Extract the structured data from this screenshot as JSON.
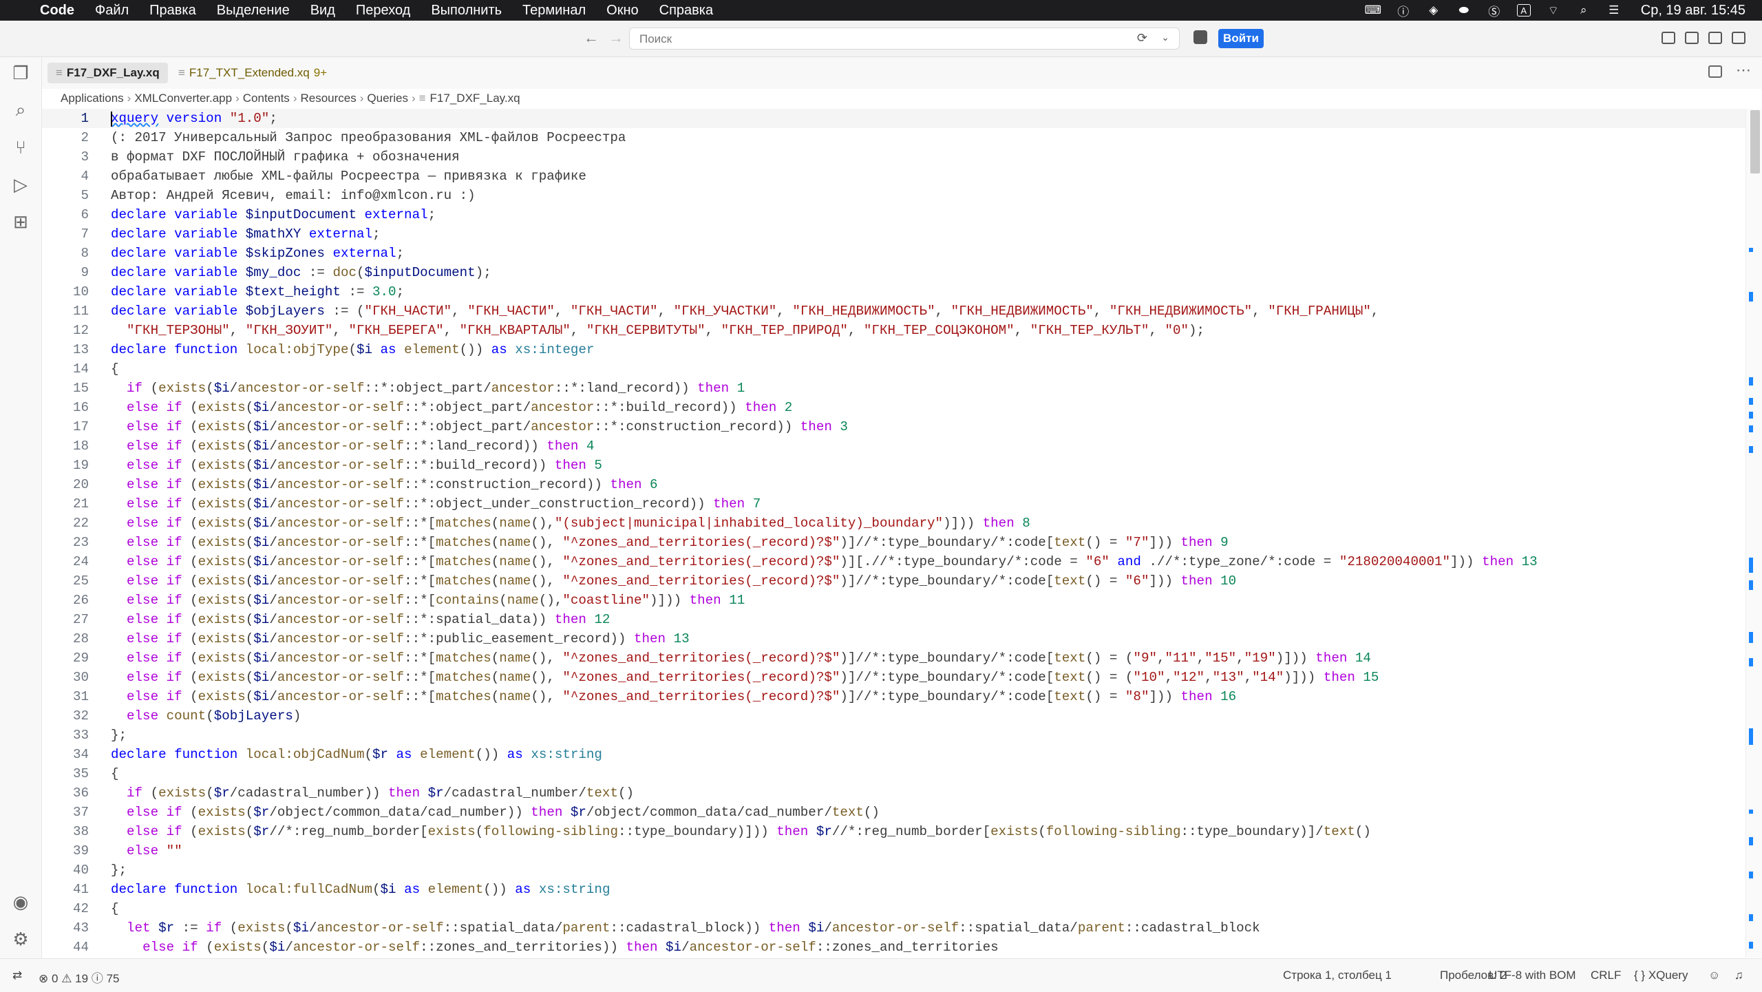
{
  "menubar": {
    "app": "Code",
    "items": [
      "Файл",
      "Правка",
      "Выделение",
      "Вид",
      "Переход",
      "Выполнить",
      "Терминал",
      "Окно",
      "Справка"
    ],
    "keyboard_layout": "A",
    "clock": "Ср, 19 авг.  15:45"
  },
  "titlebar": {
    "search_placeholder": "Поиск",
    "sign_in": "Войти"
  },
  "tabs": [
    {
      "label": "F17_DXF_Lay.xq",
      "active": true
    },
    {
      "label": "F17_TXT_Extended.xq",
      "badge": "9+"
    }
  ],
  "breadcrumb": [
    "Applications",
    "XMLConverter.app",
    "Contents",
    "Resources",
    "Queries",
    "F17_DXF_Lay.xq"
  ],
  "status": {
    "errors": "0",
    "warnings": "19",
    "infos": "75",
    "position": "Строка 1, столбец 1",
    "spaces": "Пробелов: 2",
    "encoding": "UTF-8 with BOM",
    "eol": "CRLF",
    "language": "XQuery"
  },
  "code_lines": [
    "xquery version \"1.0\";",
    "(: 2017 Универсальный Запрос преобразования XML-файлов Росреестра",
    "в формат DXF ПОСЛОЙНЫЙ графика + обозначения",
    "обрабатывает любые XML-файлы Росреестра — привязка к графике",
    "Автор: Андрей Ясевич, email: info@xmlcon.ru :)",
    "declare variable $inputDocument external;",
    "declare variable $mathXY external;",
    "declare variable $skipZones external;",
    "declare variable $my_doc := doc($inputDocument);",
    "declare variable $text_height := 3.0;",
    "declare variable $objLayers := (\"ГКН_ЧАСТИ\", \"ГКН_ЧАСТИ\", \"ГКН_ЧАСТИ\", \"ГКН_УЧАСТКИ\", \"ГКН_НЕДВИЖИМОСТЬ\", \"ГКН_НЕДВИЖИМОСТЬ\", \"ГКН_НЕДВИЖИМОСТЬ\", \"ГКН_ГРАНИЦЫ\",",
    "  \"ГКН_ТЕРЗОНЫ\", \"ГКН_ЗОУИТ\", \"ГКН_БЕРЕГА\", \"ГКН_КВАРТАЛЫ\", \"ГКН_СЕРВИТУТЫ\", \"ГКН_ТЕР_ПРИРОД\", \"ГКН_ТЕР_СОЦЭКОНОМ\", \"ГКН_ТЕР_КУЛЬТ\", \"0\");",
    "declare function local:objType($i as element()) as xs:integer",
    "{",
    "  if (exists($i/ancestor-or-self::*:object_part/ancestor::*:land_record)) then 1",
    "  else if (exists($i/ancestor-or-self::*:object_part/ancestor::*:build_record)) then 2",
    "  else if (exists($i/ancestor-or-self::*:object_part/ancestor::*:construction_record)) then 3",
    "  else if (exists($i/ancestor-or-self::*:land_record)) then 4",
    "  else if (exists($i/ancestor-or-self::*:build_record)) then 5",
    "  else if (exists($i/ancestor-or-self::*:construction_record)) then 6",
    "  else if (exists($i/ancestor-or-self::*:object_under_construction_record)) then 7",
    "  else if (exists($i/ancestor-or-self::*[matches(name(),\"(subject|municipal|inhabited_locality)_boundary\")])) then 8",
    "  else if (exists($i/ancestor-or-self::*[matches(name(), \"^zones_and_territories(_record)?$\")]//*:type_boundary/*:code[text() = \"7\"])) then 9",
    "  else if (exists($i/ancestor-or-self::*[matches(name(), \"^zones_and_territories(_record)?$\")][.//*:type_boundary/*:code = \"6\" and .//*:type_zone/*:code = \"218020040001\"])) then 13",
    "  else if (exists($i/ancestor-or-self::*[matches(name(), \"^zones_and_territories(_record)?$\")]//*:type_boundary/*:code[text() = \"6\"])) then 10",
    "  else if (exists($i/ancestor-or-self::*[contains(name(),\"coastline\")])) then 11",
    "  else if (exists($i/ancestor-or-self::*:spatial_data)) then 12",
    "  else if (exists($i/ancestor-or-self::*:public_easement_record)) then 13",
    "  else if (exists($i/ancestor-or-self::*[matches(name(), \"^zones_and_territories(_record)?$\")]//*:type_boundary/*:code[text() = (\"9\",\"11\",\"15\",\"19\")])) then 14",
    "  else if (exists($i/ancestor-or-self::*[matches(name(), \"^zones_and_territories(_record)?$\")]//*:type_boundary/*:code[text() = (\"10\",\"12\",\"13\",\"14\")])) then 15",
    "  else if (exists($i/ancestor-or-self::*[matches(name(), \"^zones_and_territories(_record)?$\")]//*:type_boundary/*:code[text() = \"8\"])) then 16",
    "  else count($objLayers)",
    "};",
    "declare function local:objCadNum($r as element()) as xs:string",
    "{",
    "  if (exists($r/cadastral_number)) then $r/cadastral_number/text()",
    "  else if (exists($r/object/common_data/cad_number)) then $r/object/common_data/cad_number/text()",
    "  else if (exists($r//*:reg_numb_border[exists(following-sibling::type_boundary)])) then $r//*:reg_numb_border[exists(following-sibling::type_boundary)]/text()",
    "  else \"\"",
    "};",
    "declare function local:fullCadNum($i as element()) as xs:string",
    "{",
    "  let $r := if (exists($i/ancestor-or-self::spatial_data/parent::cadastral_block)) then $i/ancestor-or-self::spatial_data/parent::cadastral_block",
    "    else if (exists($i/ancestor-or-self::zones_and_territories)) then $i/ancestor-or-self::zones_and_territories"
  ]
}
